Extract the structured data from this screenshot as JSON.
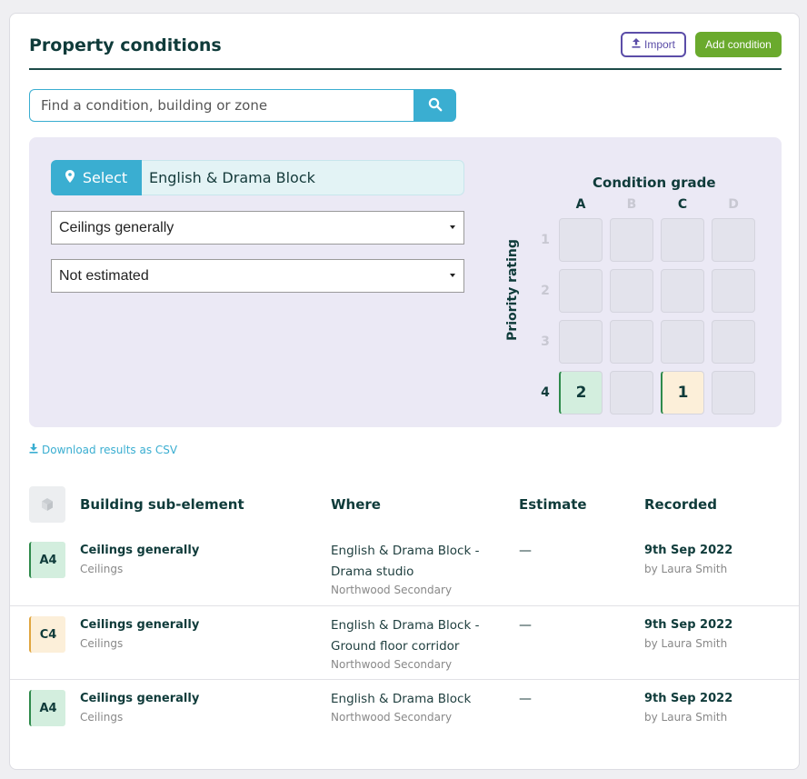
{
  "header": {
    "title": "Property conditions",
    "import_label": "Import",
    "add_label": "Add condition"
  },
  "search": {
    "placeholder": "Find a condition, building or zone"
  },
  "filters": {
    "select_label": "Select",
    "location": "English & Drama Block",
    "sub_element": "Ceilings generally",
    "estimate": "Not estimated"
  },
  "matrix": {
    "title": "Condition grade",
    "axis_label": "Priority rating",
    "grades": [
      "A",
      "B",
      "C",
      "D"
    ],
    "priorities": [
      "1",
      "2",
      "3",
      "4"
    ],
    "counts": {
      "A4": "2",
      "C4": "1"
    }
  },
  "download_label": "Download results as CSV",
  "table": {
    "headers": [
      "Building sub-element",
      "Where",
      "Estimate",
      "Recorded"
    ],
    "rows": [
      {
        "code": "A4",
        "title": "Ceilings generally",
        "category": "Ceilings",
        "where_line1": "English & Drama Block -",
        "where_line2": "Drama studio",
        "site": "Northwood Secondary",
        "estimate": "—",
        "date": "9th Sep 2022",
        "by": "by Laura Smith"
      },
      {
        "code": "C4",
        "title": "Ceilings generally",
        "category": "Ceilings",
        "where_line1": "English & Drama Block -",
        "where_line2": "Ground floor corridor",
        "site": "Northwood Secondary",
        "estimate": "—",
        "date": "9th Sep 2022",
        "by": "by Laura Smith"
      },
      {
        "code": "A4",
        "title": "Ceilings generally",
        "category": "Ceilings",
        "where_line1": "English & Drama Block",
        "site": "Northwood Secondary",
        "estimate": "—",
        "date": "9th Sep 2022",
        "by": "by Laura Smith"
      }
    ]
  },
  "colors": {
    "primary": "#3aaed1",
    "add_button": "#6aaa2d",
    "import_outline": "#5b4da8",
    "grade_a": "#d3eede",
    "grade_c": "#fcefd9",
    "heading": "#0f3b3a"
  }
}
